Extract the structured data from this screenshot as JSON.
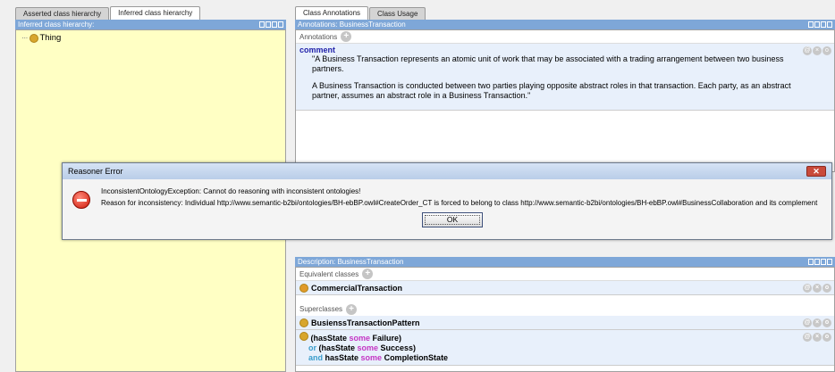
{
  "left": {
    "tabs": [
      "Asserted class hierarchy",
      "Inferred class hierarchy"
    ],
    "title": "Inferred class hierarchy:",
    "tree_root": "Thing"
  },
  "right": {
    "tabs": [
      "Class Annotations",
      "Class Usage"
    ],
    "annotations_title": "Annotations: BusinessTransaction",
    "annotations_section": "Annotations",
    "annotation_label": "comment",
    "annotation_p1": "\"A Business Transaction represents an atomic unit of work that may be associated with a trading arrangement between two business partners.",
    "annotation_p2": "A Business Transaction is conducted between two parties playing opposite abstract roles in that transaction. Each party, as an abstract partner, assumes an abstract role in a Business Transaction.\"",
    "description_title": "Description: BusinessTransaction",
    "equivalent_label": "Equivalent classes",
    "equivalent_item": "CommercialTransaction",
    "superclasses_label": "Superclasses",
    "superclass_item": "BusienssTransactionPattern",
    "expr_line1_a": "(hasState ",
    "expr_some": "some",
    "expr_line1_b": " Failure)",
    "expr_or": "or",
    "expr_line2_a": " (hasState ",
    "expr_line2_b": " Success)",
    "expr_and": "and",
    "expr_line3_a": " hasState ",
    "expr_line3_b": " CompletionState"
  },
  "dialog": {
    "title": "Reasoner Error",
    "close": "✕",
    "line1": "InconsistentOntologyException: Cannot do reasoning with inconsistent ontologies!",
    "line2": "Reason for inconsistency: Individual http://www.semantic-b2bi/ontologies/BH-ebBP.owl#CreateOrder_CT is forced to belong to class http://www.semantic-b2bi/ontologies/BH-ebBP.owl#BusinessCollaboration and its complement",
    "ok": "OK"
  },
  "colors": {
    "title_bar": "#7ea7d8",
    "tree_bg": "#ffffc4",
    "row_bg": "#e8f0fb",
    "class_dot": "#d8a62c"
  }
}
